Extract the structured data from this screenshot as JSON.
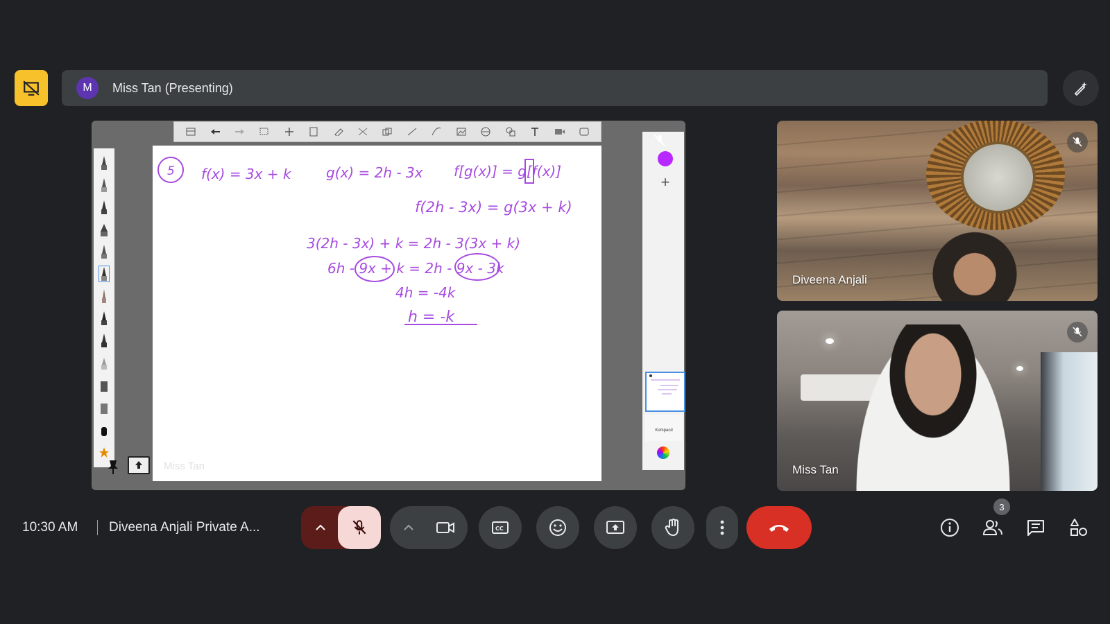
{
  "presenter_bar": {
    "avatar_initial": "M",
    "presenter_label": "Miss Tan (Presenting)"
  },
  "shared_screen": {
    "watermark": "Miss Tan",
    "page_thumb_caption": "Kompacd",
    "ink_color": "#a64ae0",
    "math": {
      "problem_number": "5",
      "line1_f": "f(x) = 3x + k",
      "line1_g": "g(x) = 2h - 3x",
      "line1_fg": "f[g(x)] = g[f(x)]",
      "line2": "f(2h - 3x) = g(3x + k)",
      "line3": "3(2h - 3x) + k = 2h - 3(3x + k)",
      "line4": "6h - 9x + k = 2h - 9x - 3k",
      "line5": "4h = -4k",
      "line6": "h = -k"
    }
  },
  "participants": [
    {
      "name": "Diveena Anjali",
      "muted": true
    },
    {
      "name": "Miss Tan",
      "muted": true
    }
  ],
  "bottom_bar": {
    "time": "10:30 AM",
    "meeting_title": "Diveena Anjali Private A...",
    "participant_count": "3"
  },
  "colors": {
    "background": "#202124",
    "present_button": "#f7c12b",
    "end_call": "#d93025",
    "mic_muted_bg": "#f6d9d6",
    "avatar": "#5e35b1"
  },
  "icons": [
    "present-off-icon",
    "annotate-icon",
    "mic-off-icon",
    "chevron-up-icon",
    "camera-icon",
    "captions-icon",
    "emoji-icon",
    "present-screen-icon",
    "raise-hand-icon",
    "more-vert-icon",
    "call-end-icon",
    "info-icon",
    "people-icon",
    "chat-icon",
    "activities-icon"
  ]
}
